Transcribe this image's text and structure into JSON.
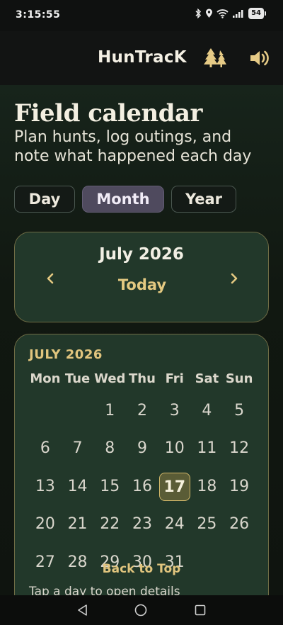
{
  "status": {
    "time": "3:15:55",
    "battery": "54"
  },
  "app": {
    "title": "HunTracK"
  },
  "header": {
    "title": "Field calendar",
    "subtitle": "Plan hunts, log outings, and note what happened each day"
  },
  "tabs": [
    {
      "label": "Day",
      "selected": false
    },
    {
      "label": "Month",
      "selected": true
    },
    {
      "label": "Year",
      "selected": false
    }
  ],
  "month_nav": {
    "label": "July 2026",
    "today": "Today",
    "prev_icon": "chevron-left",
    "next_icon": "chevron-right"
  },
  "calendar": {
    "heading": "JULY 2026",
    "weekdays": [
      "Mon",
      "Tue",
      "Wed",
      "Thu",
      "Fri",
      "Sat",
      "Sun"
    ],
    "first_weekday_index": 2,
    "days_in_month": 31,
    "today": 17,
    "back_to_top": "Back to Top",
    "hint": "Tap a day to open details"
  },
  "colors": {
    "accent": "#e1c57e",
    "card": "#22382a",
    "selected_tab": "#4f4a5e"
  }
}
